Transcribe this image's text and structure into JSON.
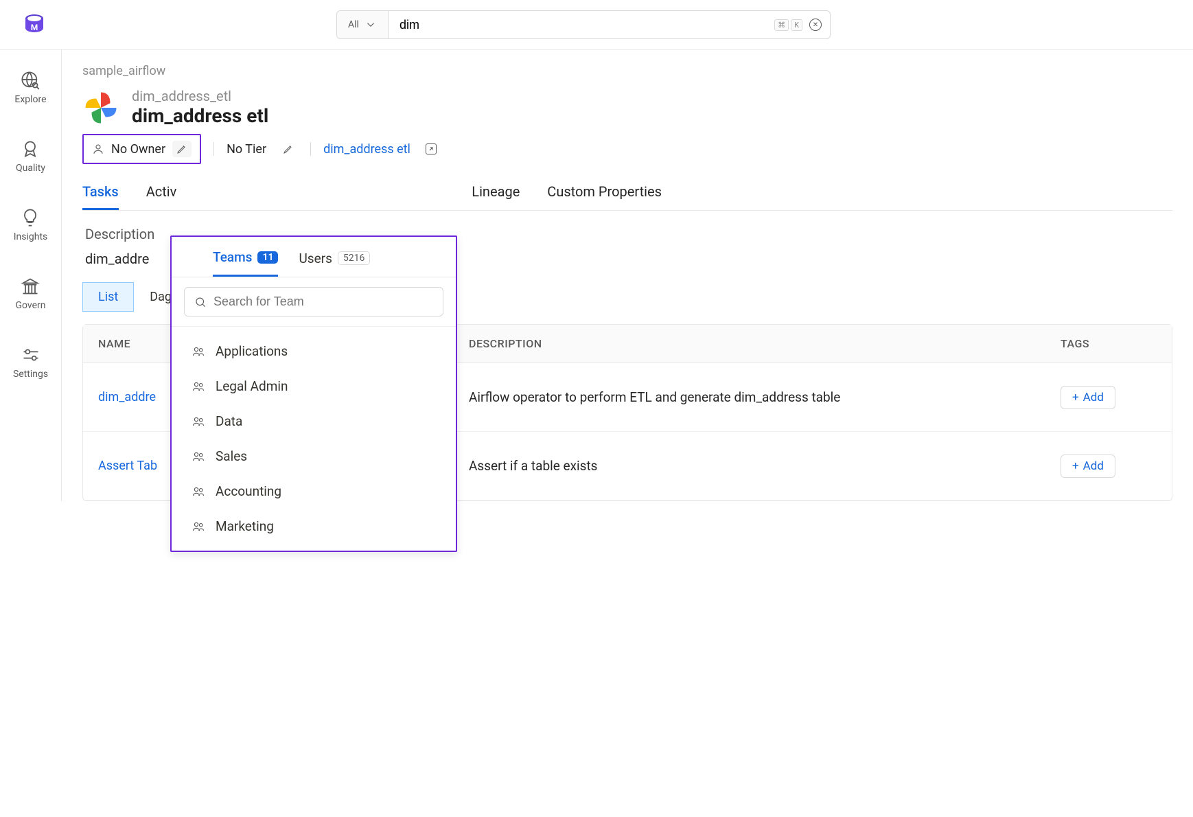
{
  "search": {
    "scope": "All",
    "value": "dim",
    "kbd1": "⌘",
    "kbd2": "K"
  },
  "leftNav": [
    {
      "label": "Explore"
    },
    {
      "label": "Quality"
    },
    {
      "label": "Insights"
    },
    {
      "label": "Govern"
    },
    {
      "label": "Settings"
    }
  ],
  "breadcrumb": "sample_airflow",
  "entity": {
    "subtitle": "dim_address_etl",
    "title": "dim_address etl"
  },
  "meta": {
    "owner": "No Owner",
    "tier": "No Tier",
    "link": "dim_address etl"
  },
  "tabs": [
    {
      "label": "Tasks",
      "active": true
    },
    {
      "label": "Activ"
    },
    {
      "label": "Lineage"
    },
    {
      "label": "Custom Properties"
    }
  ],
  "descLabel": "Description",
  "descText": "dim_addre",
  "innerTabs": [
    {
      "label": "List",
      "active": true
    },
    {
      "label": "Dag"
    }
  ],
  "table": {
    "columns": {
      "name": "NAME",
      "desc": "DESCRIPTION",
      "tags": "TAGS"
    },
    "rows": [
      {
        "name": "dim_addre",
        "desc": "Airflow operator to perform ETL and generate dim_address table",
        "add": "Add"
      },
      {
        "name": "Assert Tab",
        "desc": "Assert if a table exists",
        "add": "Add"
      }
    ]
  },
  "popover": {
    "tabs": {
      "teams": {
        "label": "Teams",
        "count": "11"
      },
      "users": {
        "label": "Users",
        "count": "5216"
      }
    },
    "searchPlaceholder": "Search for Team",
    "teams": [
      "Applications",
      "Legal Admin",
      "Data",
      "Sales",
      "Accounting",
      "Marketing"
    ]
  }
}
